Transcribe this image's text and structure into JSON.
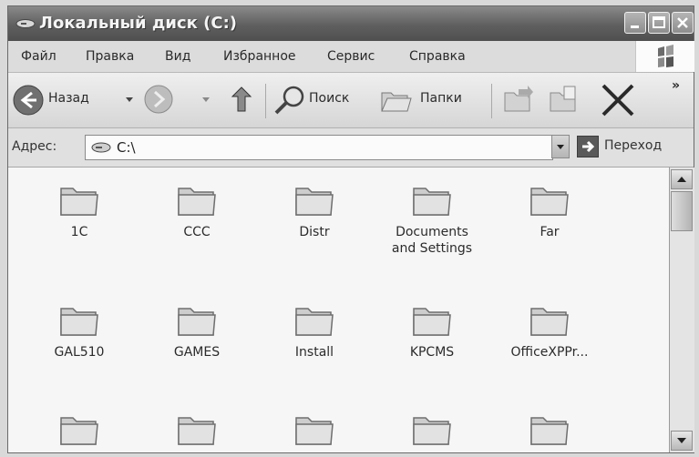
{
  "window": {
    "title": "Локальный диск (C:)"
  },
  "menu": {
    "items": [
      "Файл",
      "Правка",
      "Вид",
      "Избранное",
      "Сервис",
      "Справка"
    ]
  },
  "toolbar": {
    "back_label": "Назад",
    "search_label": "Поиск",
    "folders_label": "Папки",
    "overflow": "»"
  },
  "address": {
    "label": "Адрес:",
    "value": "C:\\",
    "go_label": "Переход"
  },
  "folders": [
    {
      "name": "1C"
    },
    {
      "name": "CCC"
    },
    {
      "name": "Distr"
    },
    {
      "name": "Documents\nand Settings"
    },
    {
      "name": "Far"
    },
    {
      "name": "GAL510"
    },
    {
      "name": "GAMES"
    },
    {
      "name": "Install"
    },
    {
      "name": "KPCMS"
    },
    {
      "name": "OfficeXPPr..."
    },
    {
      "name": ""
    },
    {
      "name": ""
    },
    {
      "name": ""
    },
    {
      "name": ""
    },
    {
      "name": ""
    }
  ]
}
